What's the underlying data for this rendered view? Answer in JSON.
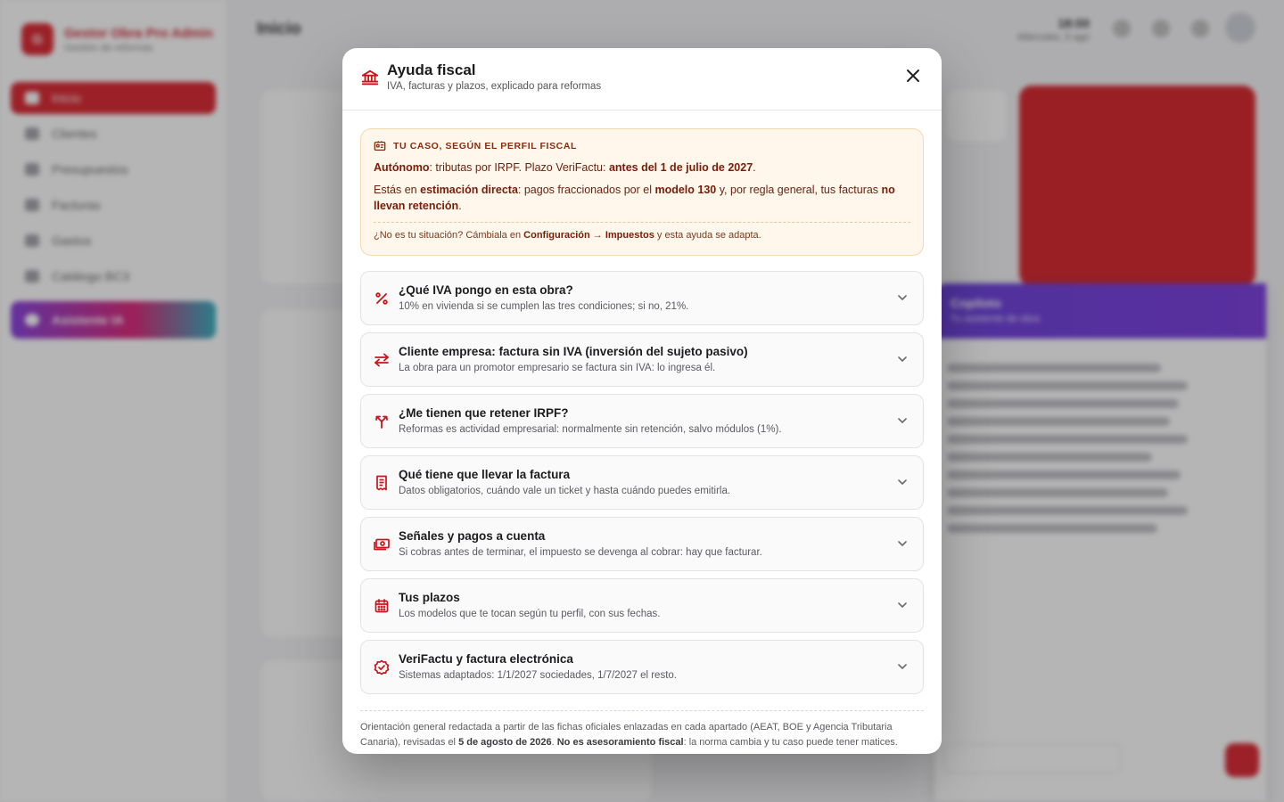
{
  "background": {
    "brand": {
      "name": "Gestor Obra Pro Admin",
      "sub": "Gestión de reformas"
    },
    "nav": [
      "Inicio",
      "Clientes",
      "Presupuestos",
      "Facturas",
      "Gastos",
      "Catálogo BC3",
      "Asistente IA"
    ],
    "page_title": "Inicio",
    "clock": {
      "time": "18:00",
      "date": "Miércoles, 5 ago"
    },
    "copilot": {
      "title": "Copiloto",
      "subtitle": "Tu asistente de obra"
    }
  },
  "modal": {
    "title": "Ayuda fiscal",
    "subtitle": "IVA, facturas y plazos, explicado para reformas",
    "close_icon": "close-icon",
    "profile": {
      "heading": "TU CASO, SEGÚN EL PERFIL FISCAL",
      "p1_b1": "Autónomo",
      "p1_t1": ": tributas por IRPF. Plazo VeriFactu: ",
      "p1_b2": "antes del 1 de julio de 2027",
      "p1_t2": ".",
      "p2_t1": "Estás en ",
      "p2_b1": "estimación directa",
      "p2_t2": ": pagos fraccionados por el ",
      "p2_b2": "modelo 130",
      "p2_t3": " y, por regla general, tus facturas ",
      "p2_b3": "no llevan retención",
      "p2_t4": ".",
      "note_t1": "¿No es tu situación? Cámbiala en ",
      "note_b1": "Configuración",
      "note_arrow": " → ",
      "note_b2": "Impuestos",
      "note_t2": " y esta ayuda se adapta."
    },
    "sections": [
      {
        "icon": "percent-icon",
        "title": "¿Qué IVA pongo en esta obra?",
        "desc": "10% en vivienda si se cumplen las tres condiciones; si no, 21%."
      },
      {
        "icon": "swap-arrows-icon",
        "title": "Cliente empresa: factura sin IVA (inversión del sujeto pasivo)",
        "desc": "La obra para un promotor empresario se factura sin IVA: lo ingresa él."
      },
      {
        "icon": "split-arrow-icon",
        "title": "¿Me tienen que retener IRPF?",
        "desc": "Reformas es actividad empresarial: normalmente sin retención, salvo módulos (1%)."
      },
      {
        "icon": "receipt-icon",
        "title": "Qué tiene que llevar la factura",
        "desc": "Datos obligatorios, cuándo vale un ticket y hasta cuándo puedes emitirla."
      },
      {
        "icon": "cash-icon",
        "title": "Señales y pagos a cuenta",
        "desc": "Si cobras antes de terminar, el impuesto se devenga al cobrar: hay que facturar."
      },
      {
        "icon": "calendar-icon",
        "title": "Tus plazos",
        "desc": "Los modelos que te tocan según tu perfil, con sus fechas."
      },
      {
        "icon": "verified-badge-icon",
        "title": "VeriFactu y factura electrónica",
        "desc": "Sistemas adaptados: 1/1/2027 sociedades, 1/7/2027 el resto."
      }
    ],
    "footer": {
      "t1": "Orientación general redactada a partir de las fichas oficiales enlazadas en cada apartado (AEAT, BOE y Agencia Tributaria Canaria), revisadas el ",
      "b1": "5 de agosto de 2026",
      "t2": ". ",
      "b2": "No es asesoramiento fiscal",
      "t3": ": la norma cambia y tu caso puede tener matices."
    }
  },
  "colors": {
    "accent": "#d6101a",
    "warning_bg": "#fff7ec",
    "warning_text": "#7a1d08"
  }
}
